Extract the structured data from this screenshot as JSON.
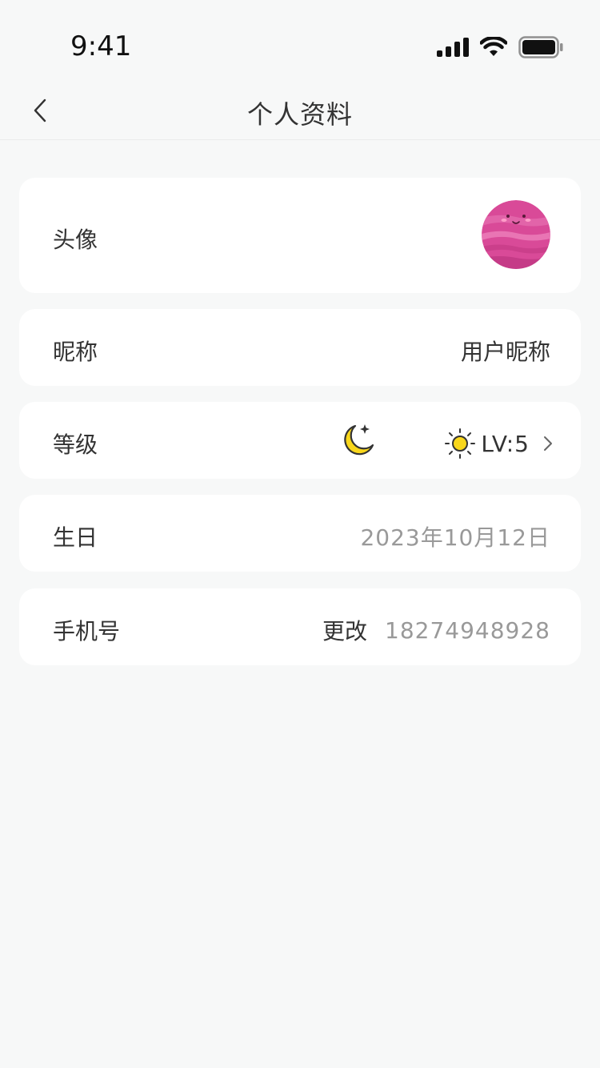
{
  "status_bar": {
    "time": "9:41"
  },
  "nav": {
    "title": "个人资料",
    "back_icon": "chevron-left-icon"
  },
  "profile": {
    "avatar": {
      "label": "头像",
      "image": "pink-planet-avatar"
    },
    "nickname": {
      "label": "昵称",
      "value": "用户昵称"
    },
    "level": {
      "label": "等级",
      "value": "LV:5",
      "moon_color": "#f9d71c",
      "sun_color": "#f9d71c"
    },
    "birthday": {
      "label": "生日",
      "value": "2023年10月12日"
    },
    "phone": {
      "label": "手机号",
      "action": "更改",
      "value": "18274948928"
    }
  },
  "colors": {
    "background": "#f7f8f8",
    "card": "#ffffff",
    "text_primary": "#333333",
    "text_secondary": "#999999",
    "accent_yellow": "#f9d71c",
    "avatar_pink": "#d94a98"
  }
}
